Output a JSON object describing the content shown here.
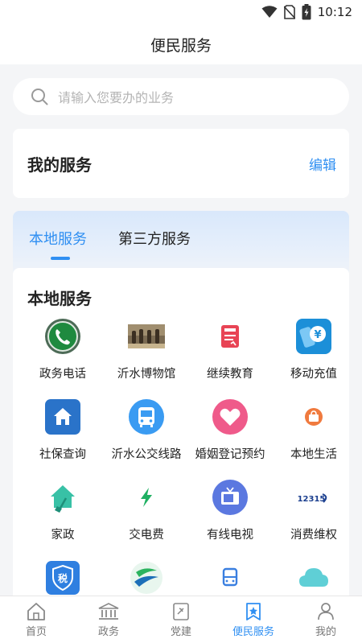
{
  "status_bar": {
    "time": "10:12"
  },
  "header": {
    "title": "便民服务"
  },
  "search": {
    "placeholder": "请输入您要办的业务"
  },
  "my_services": {
    "heading": "我的服务",
    "edit_label": "编辑"
  },
  "tabs": [
    {
      "label": "本地服务",
      "active": true
    },
    {
      "label": "第三方服务",
      "active": false
    }
  ],
  "local_services": {
    "heading": "本地服务",
    "items": [
      {
        "label": "政务电话",
        "icon": "phone-icon"
      },
      {
        "label": "沂水博物馆",
        "icon": "museum-icon"
      },
      {
        "label": "继续教育",
        "icon": "education-icon"
      },
      {
        "label": "移动充值",
        "icon": "mobile-recharge-icon"
      },
      {
        "label": "社保查询",
        "icon": "social-security-icon"
      },
      {
        "label": "沂水公交线路",
        "icon": "bus-icon"
      },
      {
        "label": "婚姻登记预约",
        "icon": "marriage-icon"
      },
      {
        "label": "本地生活",
        "icon": "local-life-icon"
      },
      {
        "label": "家政",
        "icon": "housekeeping-icon"
      },
      {
        "label": "交电费",
        "icon": "electricity-icon"
      },
      {
        "label": "有线电视",
        "icon": "tv-icon"
      },
      {
        "label": "消费维权",
        "icon": "consumer-rights-icon"
      },
      {
        "label": "",
        "icon": "tax-icon"
      },
      {
        "label": "",
        "icon": "scenic-icon"
      },
      {
        "label": "",
        "icon": "bus-stop-icon"
      },
      {
        "label": "",
        "icon": "weather-icon"
      }
    ],
    "badge_text": {
      "tax": "税",
      "hotline": "12315"
    }
  },
  "bottom_nav": [
    {
      "label": "首页",
      "icon": "home-icon",
      "active": false
    },
    {
      "label": "政务",
      "icon": "government-icon",
      "active": false
    },
    {
      "label": "党建",
      "icon": "party-icon",
      "active": false
    },
    {
      "label": "便民服务",
      "icon": "service-star-icon",
      "active": true
    },
    {
      "label": "我的",
      "icon": "profile-icon",
      "active": false
    }
  ],
  "colors": {
    "accent": "#2f8ff2",
    "background": "#f4f5f7",
    "text": "#222222",
    "muted": "#777777"
  }
}
